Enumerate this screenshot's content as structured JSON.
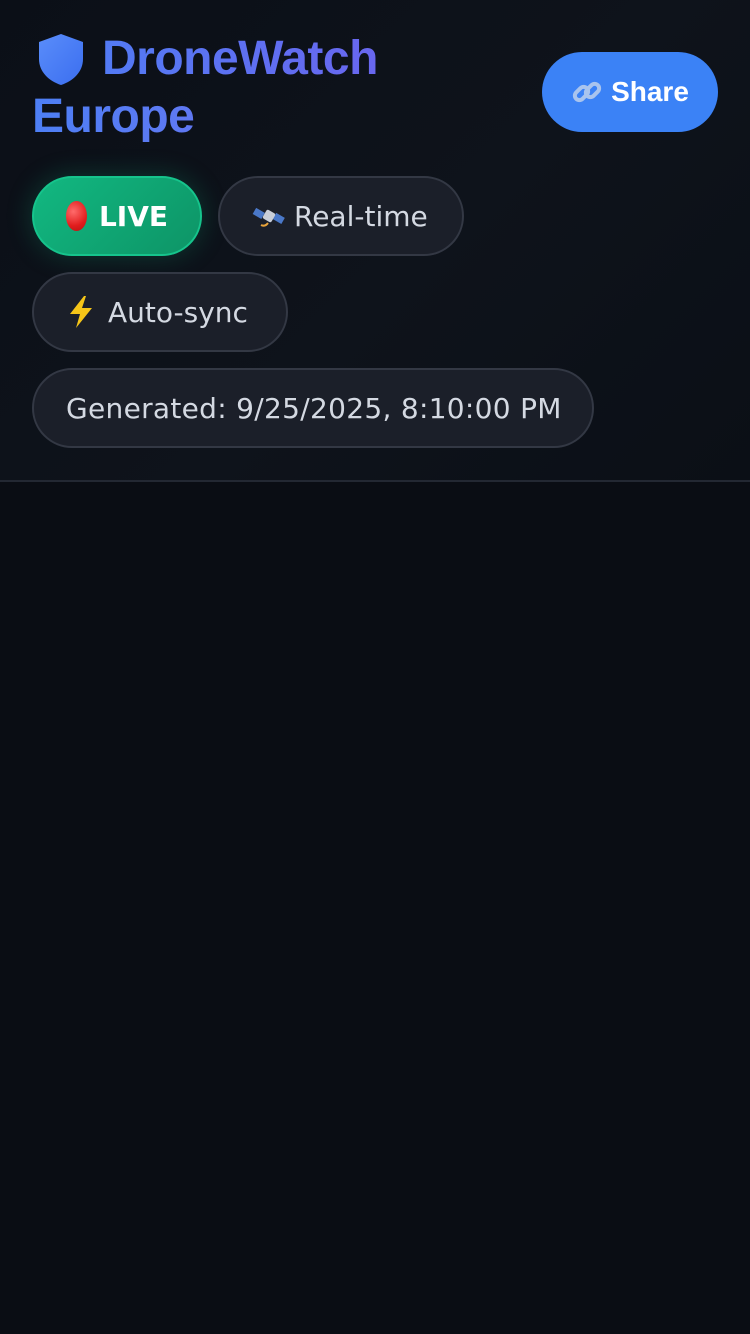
{
  "header": {
    "brand_line1": "DroneWatch",
    "brand_line2": "Europe",
    "brand_icon": "shield-icon",
    "share": {
      "label": "Share",
      "icon": "link-icon"
    }
  },
  "status": {
    "live": {
      "label": "LIVE",
      "icon": "red-dot-icon"
    },
    "realtime": {
      "label": "Real-time",
      "icon": "satellite-icon"
    },
    "autosync": {
      "label": "Auto-sync",
      "icon": "lightning-icon"
    },
    "generated": {
      "label": "Generated: 9/25/2025, 8:10:00 PM"
    }
  },
  "colors": {
    "background": "#0a0d14",
    "brand_gradient_start": "#4d7ff5",
    "brand_gradient_end": "#6d63ee",
    "share_button": "#3b82f6",
    "live_green": "#10b981",
    "pill_bg": "#1b1f29"
  }
}
